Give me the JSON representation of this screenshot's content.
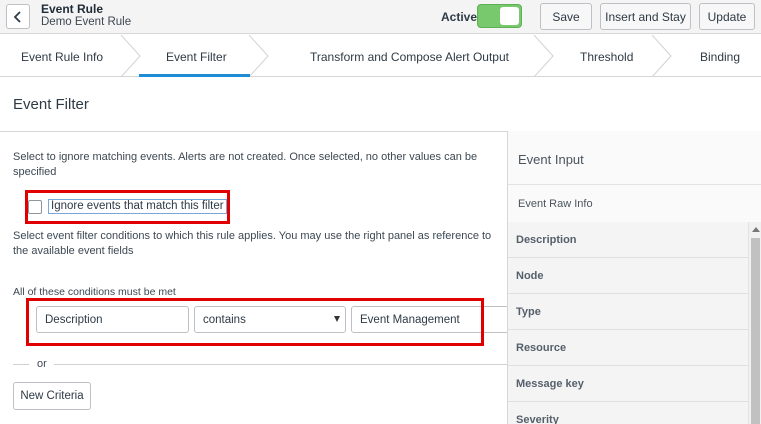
{
  "header": {
    "title": "Event Rule",
    "subtitle": "Demo Event Rule",
    "active_label": "Active",
    "active": true,
    "buttons": {
      "save": "Save",
      "insert_and_stay": "Insert and Stay",
      "update": "Update"
    }
  },
  "tabs": [
    {
      "label": "Event Rule Info"
    },
    {
      "label": "Event Filter",
      "active": true
    },
    {
      "label": "Transform and Compose Alert Output"
    },
    {
      "label": "Threshold"
    },
    {
      "label": "Binding"
    }
  ],
  "section": {
    "title": "Event Filter"
  },
  "filter": {
    "ignore_help": "Select to ignore matching events. Alerts are not created. Once selected, no other values can be specified",
    "ignore_checkbox_label": "Ignore events that match this filter",
    "ignore_checked": false,
    "conditions_help": "Select event filter conditions to which this rule applies. You may use the right panel as reference to the available event fields",
    "conditions_label": "All of these conditions must be met",
    "condition": {
      "field": "Description",
      "operator": "contains",
      "value": "Event Management"
    },
    "or_label": "or",
    "new_criteria_label": "New Criteria"
  },
  "right_panel": {
    "title": "Event Input",
    "subtitle": "Event Raw Info",
    "fields": [
      "Description",
      "Node",
      "Type",
      "Resource",
      "Message key",
      "Severity"
    ]
  },
  "colors": {
    "toggle_on": "#78c96e",
    "active_tab_bar": "#1f8dd6",
    "highlight": "#e00000"
  }
}
